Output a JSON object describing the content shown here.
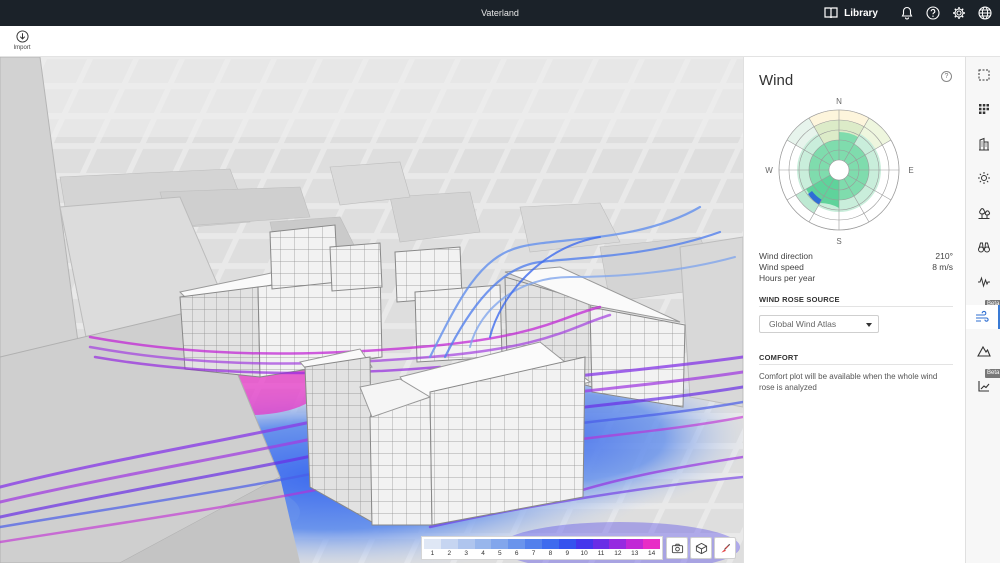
{
  "topbar": {
    "title": "Vaterland",
    "library_label": "Library",
    "icons": [
      "book-icon",
      "bell-icon",
      "help-circle-icon",
      "gear-icon",
      "globe-icon"
    ]
  },
  "toolbar": {
    "import_label": "Import"
  },
  "legend": {
    "values": [
      "1",
      "2",
      "3",
      "4",
      "5",
      "6",
      "7",
      "8",
      "9",
      "10",
      "11",
      "12",
      "13",
      "14"
    ],
    "colors": [
      "#dfe7f5",
      "#c6d5f1",
      "#afc5ee",
      "#98b6ec",
      "#82a6ec",
      "#6a94ec",
      "#5380ec",
      "#3e6bee",
      "#3552ee",
      "#4536ec",
      "#6a2ee6",
      "#962ae0",
      "#c128d6",
      "#e82ec6"
    ]
  },
  "viewport_buttons": [
    "camera-icon",
    "box-view-icon",
    "compass-icon"
  ],
  "panel": {
    "title": "Wind",
    "compass": {
      "n": "N",
      "e": "E",
      "s": "S",
      "w": "W"
    },
    "rows": [
      {
        "label": "Wind direction",
        "value": "210°"
      },
      {
        "label": "Wind speed",
        "value": "8 m/s"
      },
      {
        "label": "Hours per year",
        "value": ""
      }
    ],
    "source_heading": "WIND ROSE SOURCE",
    "source_selected": "Global Wind Atlas",
    "comfort_heading": "COMFORT",
    "comfort_text": "Comfort plot will be available when the whole wind rose is analyzed"
  },
  "sidebar": {
    "items": [
      "selection-icon",
      "grid-icon",
      "building-icon",
      "sun-icon",
      "trees-icon",
      "binoculars-icon",
      "noise-wave-icon",
      "wind-icon",
      "terrain-icon",
      "chart-icon"
    ],
    "beta_label": "Beta"
  }
}
